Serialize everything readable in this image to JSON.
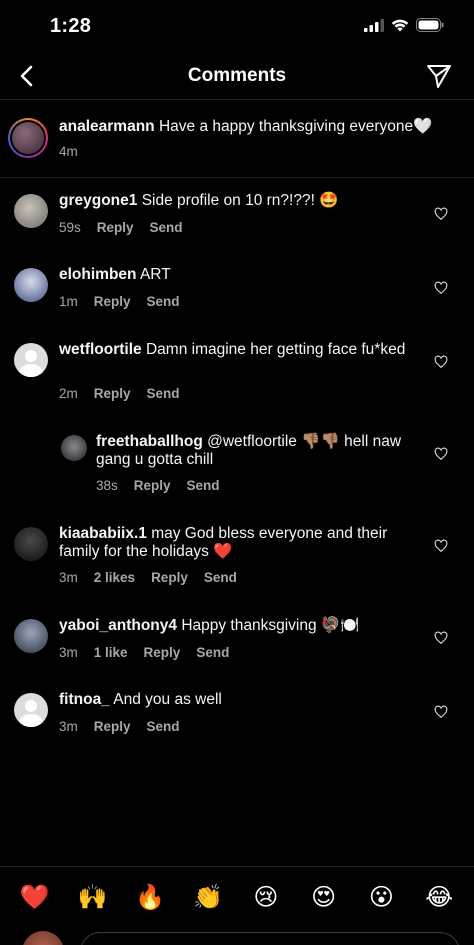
{
  "status_bar": {
    "time": "1:28"
  },
  "nav": {
    "title": "Comments"
  },
  "caption": {
    "user": "analearmann",
    "text": "Have a happy thanksgiving everyone🤍",
    "time": "4m"
  },
  "comments": [
    {
      "user": "greygone1",
      "text": "Side profile on 10 rn?!??! 🤩",
      "time": "59s",
      "likes": "",
      "reply": "Reply",
      "send": "Send"
    },
    {
      "user": "elohimben",
      "text": "ART",
      "time": "1m",
      "likes": "",
      "reply": "Reply",
      "send": "Send"
    },
    {
      "user": "wetfloortile",
      "text": "Damn imagine her getting face fu*ked",
      "time": "2m",
      "likes": "",
      "reply": "Reply",
      "send": "Send"
    },
    {
      "user": "freethaballhog",
      "text": "@wetfloortile 👎🏽👎🏽 hell naw gang u gotta chill",
      "time": "38s",
      "likes": "",
      "reply": "Reply",
      "send": "Send"
    },
    {
      "user": "kiaababiix.1",
      "text": "may God bless everyone and their family for the holidays ❤️",
      "time": "3m",
      "likes": "2 likes",
      "reply": "Reply",
      "send": "Send"
    },
    {
      "user": "yaboi_anthony4",
      "text": "Happy thanksgiving 🦃🍽️",
      "time": "3m",
      "likes": "1 like",
      "reply": "Reply",
      "send": "Send"
    },
    {
      "user": "fitnoa_",
      "text": "And you as well",
      "time": "3m",
      "likes": "",
      "reply": "Reply",
      "send": "Send"
    }
  ],
  "reactions": [
    "❤️",
    "🙌",
    "🔥",
    "👏",
    "😢",
    "😍",
    "😮",
    "😂"
  ],
  "colors": {
    "background": "#000000",
    "meta_text": "#a8a8a8",
    "divider": "#1f1f1f"
  }
}
